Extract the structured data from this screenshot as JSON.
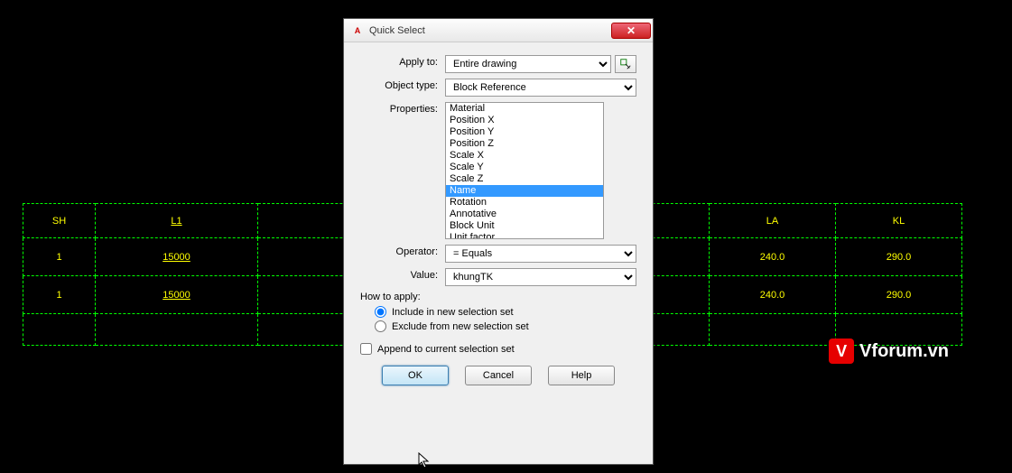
{
  "cad": {
    "headers": {
      "sh": "SH",
      "l1": "L1",
      "la": "LA",
      "kl": "KL"
    },
    "rows": [
      {
        "sh": "1",
        "l1": "15000",
        "la": "240.0",
        "kl": "290.0"
      },
      {
        "sh": "1",
        "l1": "15000",
        "la": "240.0",
        "kl": "290.0"
      }
    ]
  },
  "watermark": {
    "badge": "V",
    "text": "Vforum.vn"
  },
  "dialog": {
    "title": "Quick Select",
    "apply_to_label": "Apply to:",
    "apply_to_value": "Entire drawing",
    "object_type_label": "Object type:",
    "object_type_value": "Block Reference",
    "properties_label": "Properties:",
    "properties": [
      "Material",
      "Position X",
      "Position Y",
      "Position Z",
      "Scale X",
      "Scale Y",
      "Scale Z",
      "Name",
      "Rotation",
      "Annotative",
      "Block Unit",
      "Unit factor"
    ],
    "properties_selected": "Name",
    "operator_label": "Operator:",
    "operator_value": "= Equals",
    "value_label": "Value:",
    "value_value": "khungTK",
    "how_to_apply_label": "How to apply:",
    "include_label": "Include in new selection set",
    "exclude_label": "Exclude from new selection set",
    "append_label": "Append to current selection set",
    "ok": "OK",
    "cancel": "Cancel",
    "help": "Help"
  }
}
